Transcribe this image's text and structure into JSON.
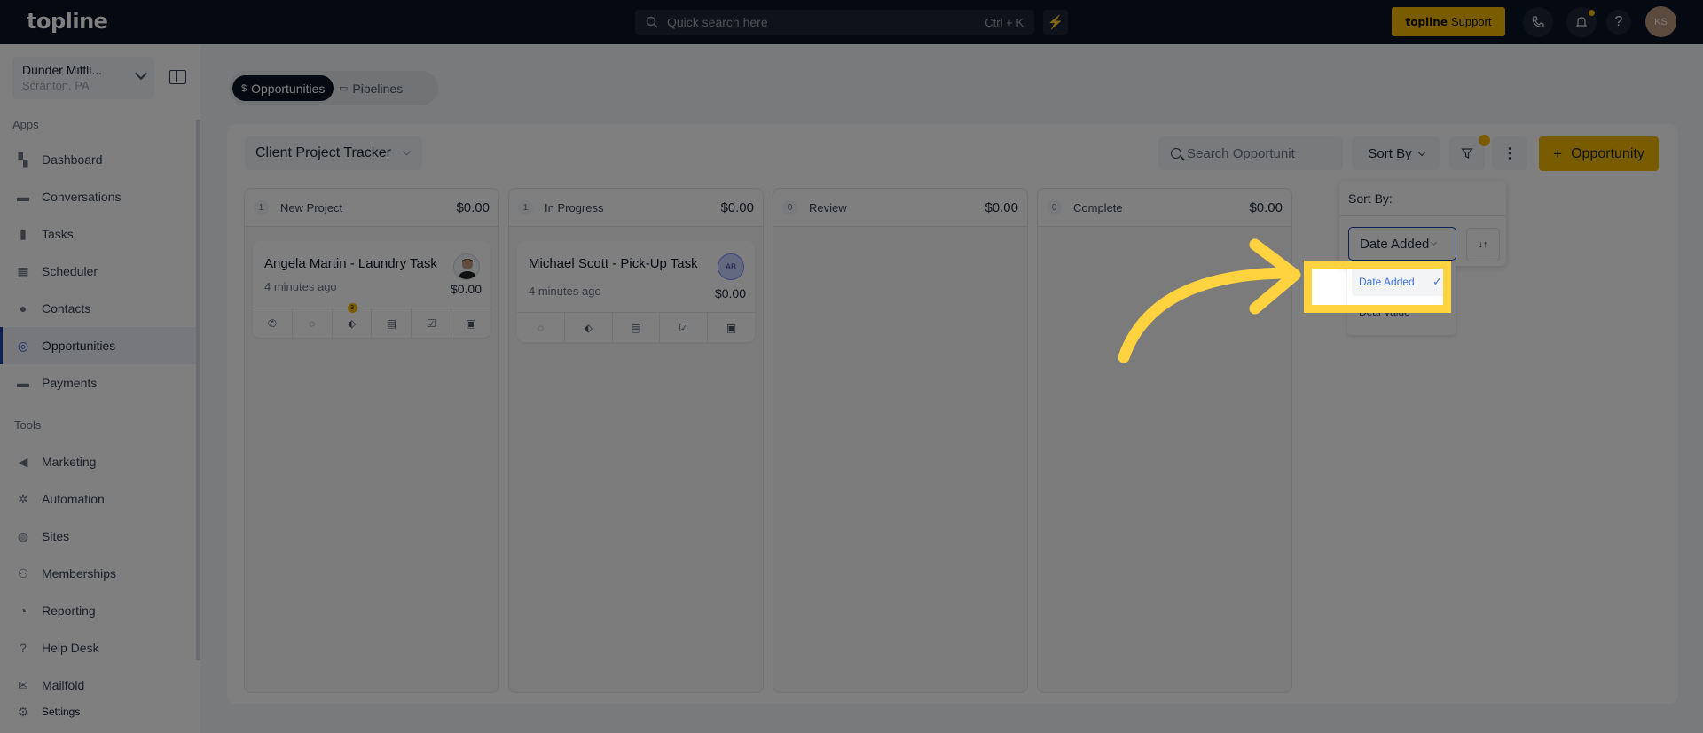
{
  "topbar": {
    "logo": "topline",
    "search_placeholder": "Quick search here",
    "search_shortcut": "Ctrl + K",
    "bolt_icon": "⚡",
    "support_brand": "topline",
    "support_label": "Support",
    "avatar_initials": "KS",
    "help_glyph": "?"
  },
  "sidebar": {
    "org_name": "Dunder Miffli...",
    "org_location": "Scranton, PA",
    "apps_label": "Apps",
    "tools_label": "Tools",
    "apps": [
      {
        "label": "Dashboard",
        "icon": "▚"
      },
      {
        "label": "Conversations",
        "icon": "▬"
      },
      {
        "label": "Tasks",
        "icon": "▮"
      },
      {
        "label": "Scheduler",
        "icon": "▦"
      },
      {
        "label": "Contacts",
        "icon": "●"
      },
      {
        "label": "Opportunities",
        "icon": "◎"
      },
      {
        "label": "Payments",
        "icon": "▬"
      }
    ],
    "tools": [
      {
        "label": "Marketing",
        "icon": "◀"
      },
      {
        "label": "Automation",
        "icon": "✲"
      },
      {
        "label": "Sites",
        "icon": "◍"
      },
      {
        "label": "Memberships",
        "icon": "⚇"
      },
      {
        "label": "Reporting",
        "icon": "◔"
      },
      {
        "label": "Help Desk",
        "icon": "?"
      },
      {
        "label": "Mailfold",
        "icon": "✉"
      }
    ],
    "settings_label": "Settings",
    "settings_icon": "⚙"
  },
  "main": {
    "tabs": [
      {
        "label": "Opportunities",
        "icon": "$",
        "active": true
      },
      {
        "label": "Pipelines",
        "icon": "▭",
        "active": false
      }
    ],
    "pipeline_select": "Client Project Tracker",
    "search_placeholder": "Search Opportunit",
    "sort_by_label": "Sort By",
    "filter_icon": "⏷",
    "more_icon": "⋮",
    "add_button": "Opportunity",
    "add_icon": "+",
    "columns": [
      {
        "count": "1",
        "title": "New Project",
        "amount": "$0.00"
      },
      {
        "count": "1",
        "title": "In Progress",
        "amount": "$0.00"
      },
      {
        "count": "0",
        "title": "Review",
        "amount": "$0.00"
      },
      {
        "count": "0",
        "title": "Complete",
        "amount": "$0.00"
      }
    ],
    "cards": [
      {
        "title": "Angela Martin - Laundry Task",
        "time": "4 minutes ago",
        "amount": "$0.00",
        "tag_badge": "3",
        "actions": [
          "✆",
          "◌",
          "⬖",
          "▤",
          "☑",
          "▣"
        ]
      },
      {
        "title": "Michael Scott - Pick-Up Task",
        "time": "4 minutes ago",
        "amount": "$0.00",
        "avatar_initials": "AB",
        "actions": [
          "◌",
          "⬖",
          "▤",
          "☑",
          "▣"
        ]
      }
    ]
  },
  "sort_popover": {
    "title": "Sort By:",
    "selected": "Date Added",
    "direction_icon": "↓↑",
    "options": [
      {
        "label": "Date Added",
        "selected": true,
        "check": "✓"
      },
      {
        "label": "Deal Value",
        "selected": false
      }
    ]
  },
  "annotation": {
    "highlight_color": "#ffd23f",
    "target": "Date Added"
  },
  "colors": {
    "topbar_bg": "#0b1225",
    "accent_yellow": "#f5b800",
    "active_blue": "#1e40af",
    "selected_text_blue": "#3b6fe0"
  }
}
